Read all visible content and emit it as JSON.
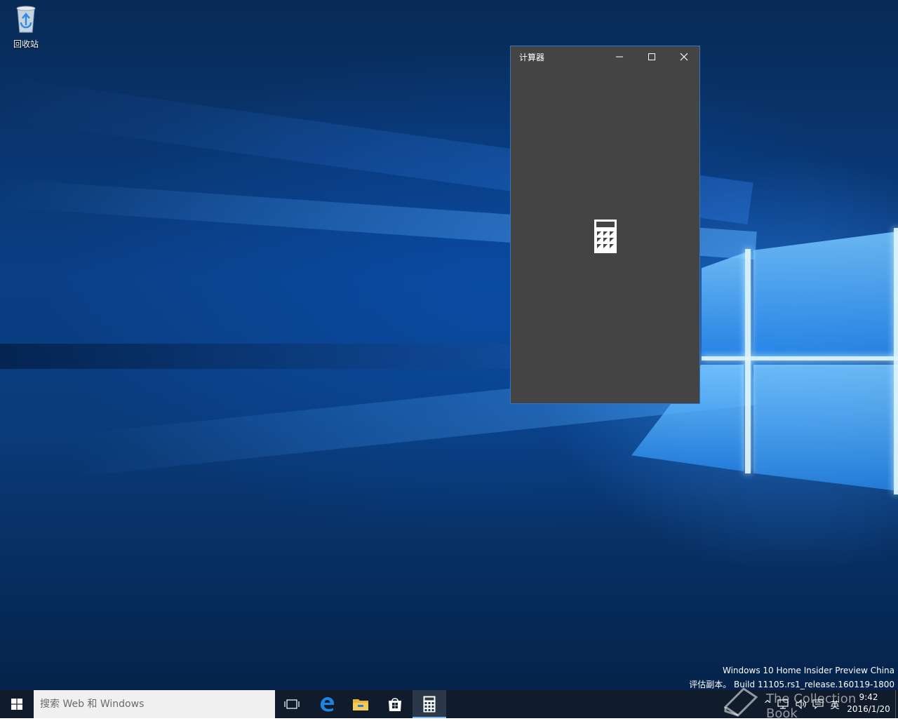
{
  "desktop": {
    "icons": [
      {
        "label": "回收站",
        "icon": "recycle-bin-icon"
      }
    ]
  },
  "calculator_window": {
    "title": "计算器",
    "controls": {
      "minimize_icon": "minimize-icon",
      "maximize_icon": "maximize-icon",
      "close_icon": "close-icon"
    },
    "splash_icon": "calculator-icon",
    "background_color": "#444444"
  },
  "watermark": {
    "line1": "Windows 10 Home Insider Preview China",
    "line2": "评估副本。 Build 11105.rs1_release.160119-1800",
    "overlay_text": "The Collection Book"
  },
  "taskbar": {
    "start_icon": "windows-logo-icon",
    "search": {
      "placeholder": "搜索 Web 和 Windows",
      "value": ""
    },
    "apps": [
      {
        "name": "task-view",
        "icon": "task-view-icon"
      },
      {
        "name": "edge",
        "icon": "edge-icon"
      },
      {
        "name": "file-explorer",
        "icon": "folder-icon"
      },
      {
        "name": "store",
        "icon": "store-icon"
      },
      {
        "name": "calculator",
        "icon": "calculator-icon",
        "active": true
      }
    ],
    "tray": {
      "chevron": "^",
      "language": "英"
    },
    "clock": {
      "time": "9:42",
      "date": "2016/1/20"
    }
  }
}
